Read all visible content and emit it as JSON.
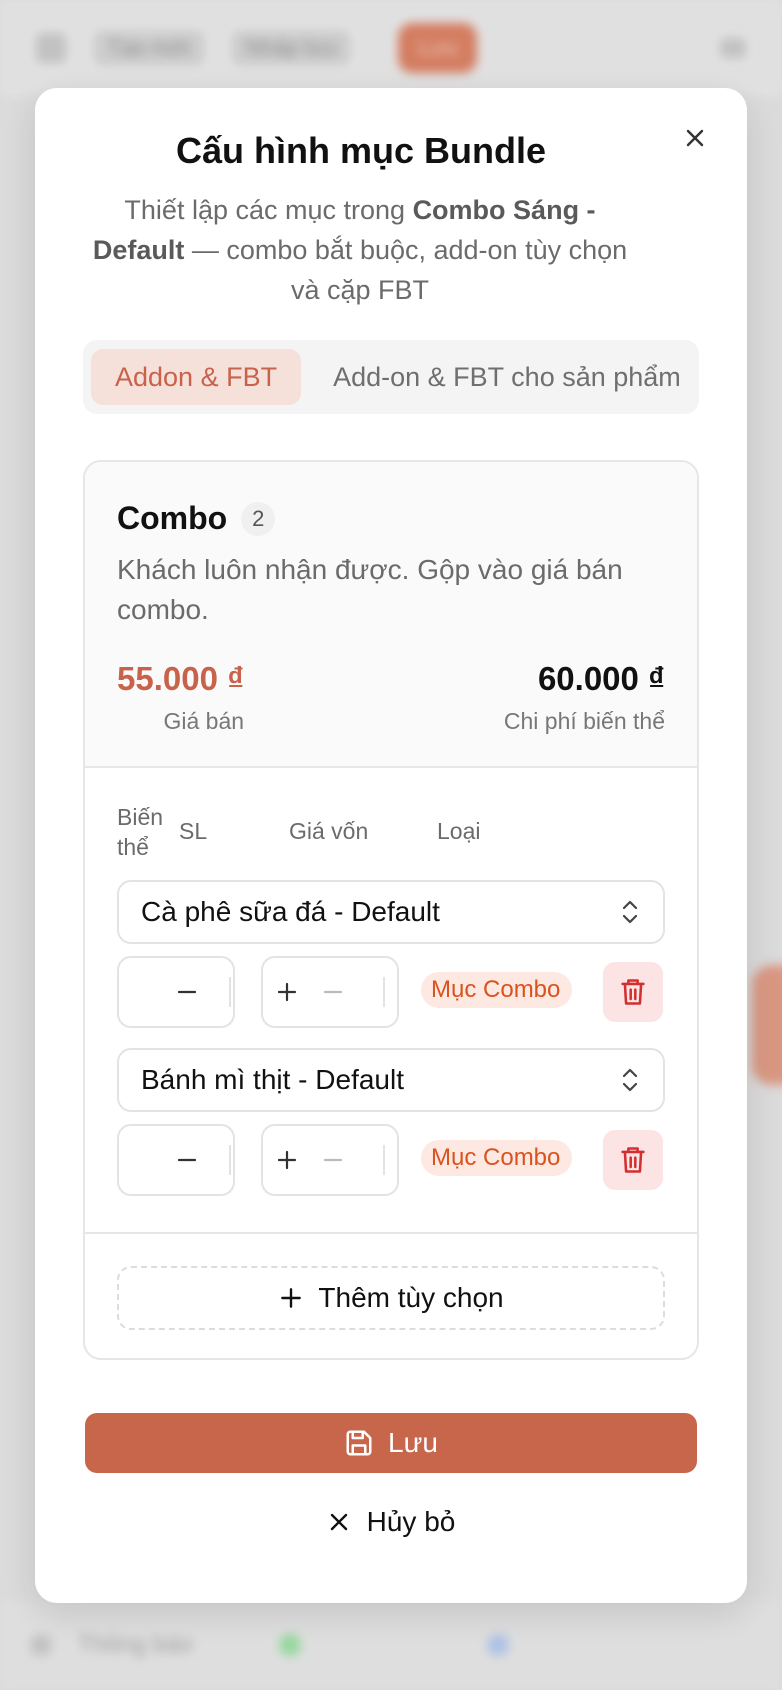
{
  "background": {
    "topbar": {
      "back_label": "Tạo mới",
      "draft_label": "Nháp lưu",
      "primary_label": "Lưu"
    },
    "bottom": {
      "status_label": "Thông báo"
    }
  },
  "modal": {
    "title": "Cấu hình mục Bundle",
    "subtitle_pre": "Thiết lập các mục trong ",
    "subtitle_bold": "Combo Sáng - Default",
    "subtitle_post": " — combo bắt buộc, add-on tùy chọn và cặp FBT",
    "tabs": [
      {
        "label": "Addon & FBT",
        "active": true
      },
      {
        "label": "Add-on & FBT cho sản phẩm",
        "active": false
      }
    ],
    "combo": {
      "title": "Combo",
      "count": "2",
      "description": "Khách luôn nhận được. Gộp vào giá bán combo.",
      "sell_price": "55.000 ₫",
      "sell_price_label": "Giá bán",
      "variant_cost": "60.000 ₫",
      "variant_cost_label": "Chi phí biến thể",
      "columns": {
        "variant": "Biến thể",
        "qty": "SL",
        "cost": "Giá vốn",
        "type": "Loại"
      },
      "items": [
        {
          "variant": "Cà phê sữa đá - Default",
          "type_badge": "Mục Combo"
        },
        {
          "variant": "Bánh mì thịt - Default",
          "type_badge": "Mục Combo"
        }
      ],
      "add_option_label": "Thêm tùy chọn"
    },
    "save_label": "Lưu",
    "cancel_label": "Hủy bỏ"
  },
  "colors": {
    "accent": "#c8664b",
    "accent_text": "#c8624a",
    "badge_bg": "#fde8e2",
    "badge_text": "#d9531e",
    "danger": "#d32f2f",
    "danger_bg": "#fde4e4"
  }
}
